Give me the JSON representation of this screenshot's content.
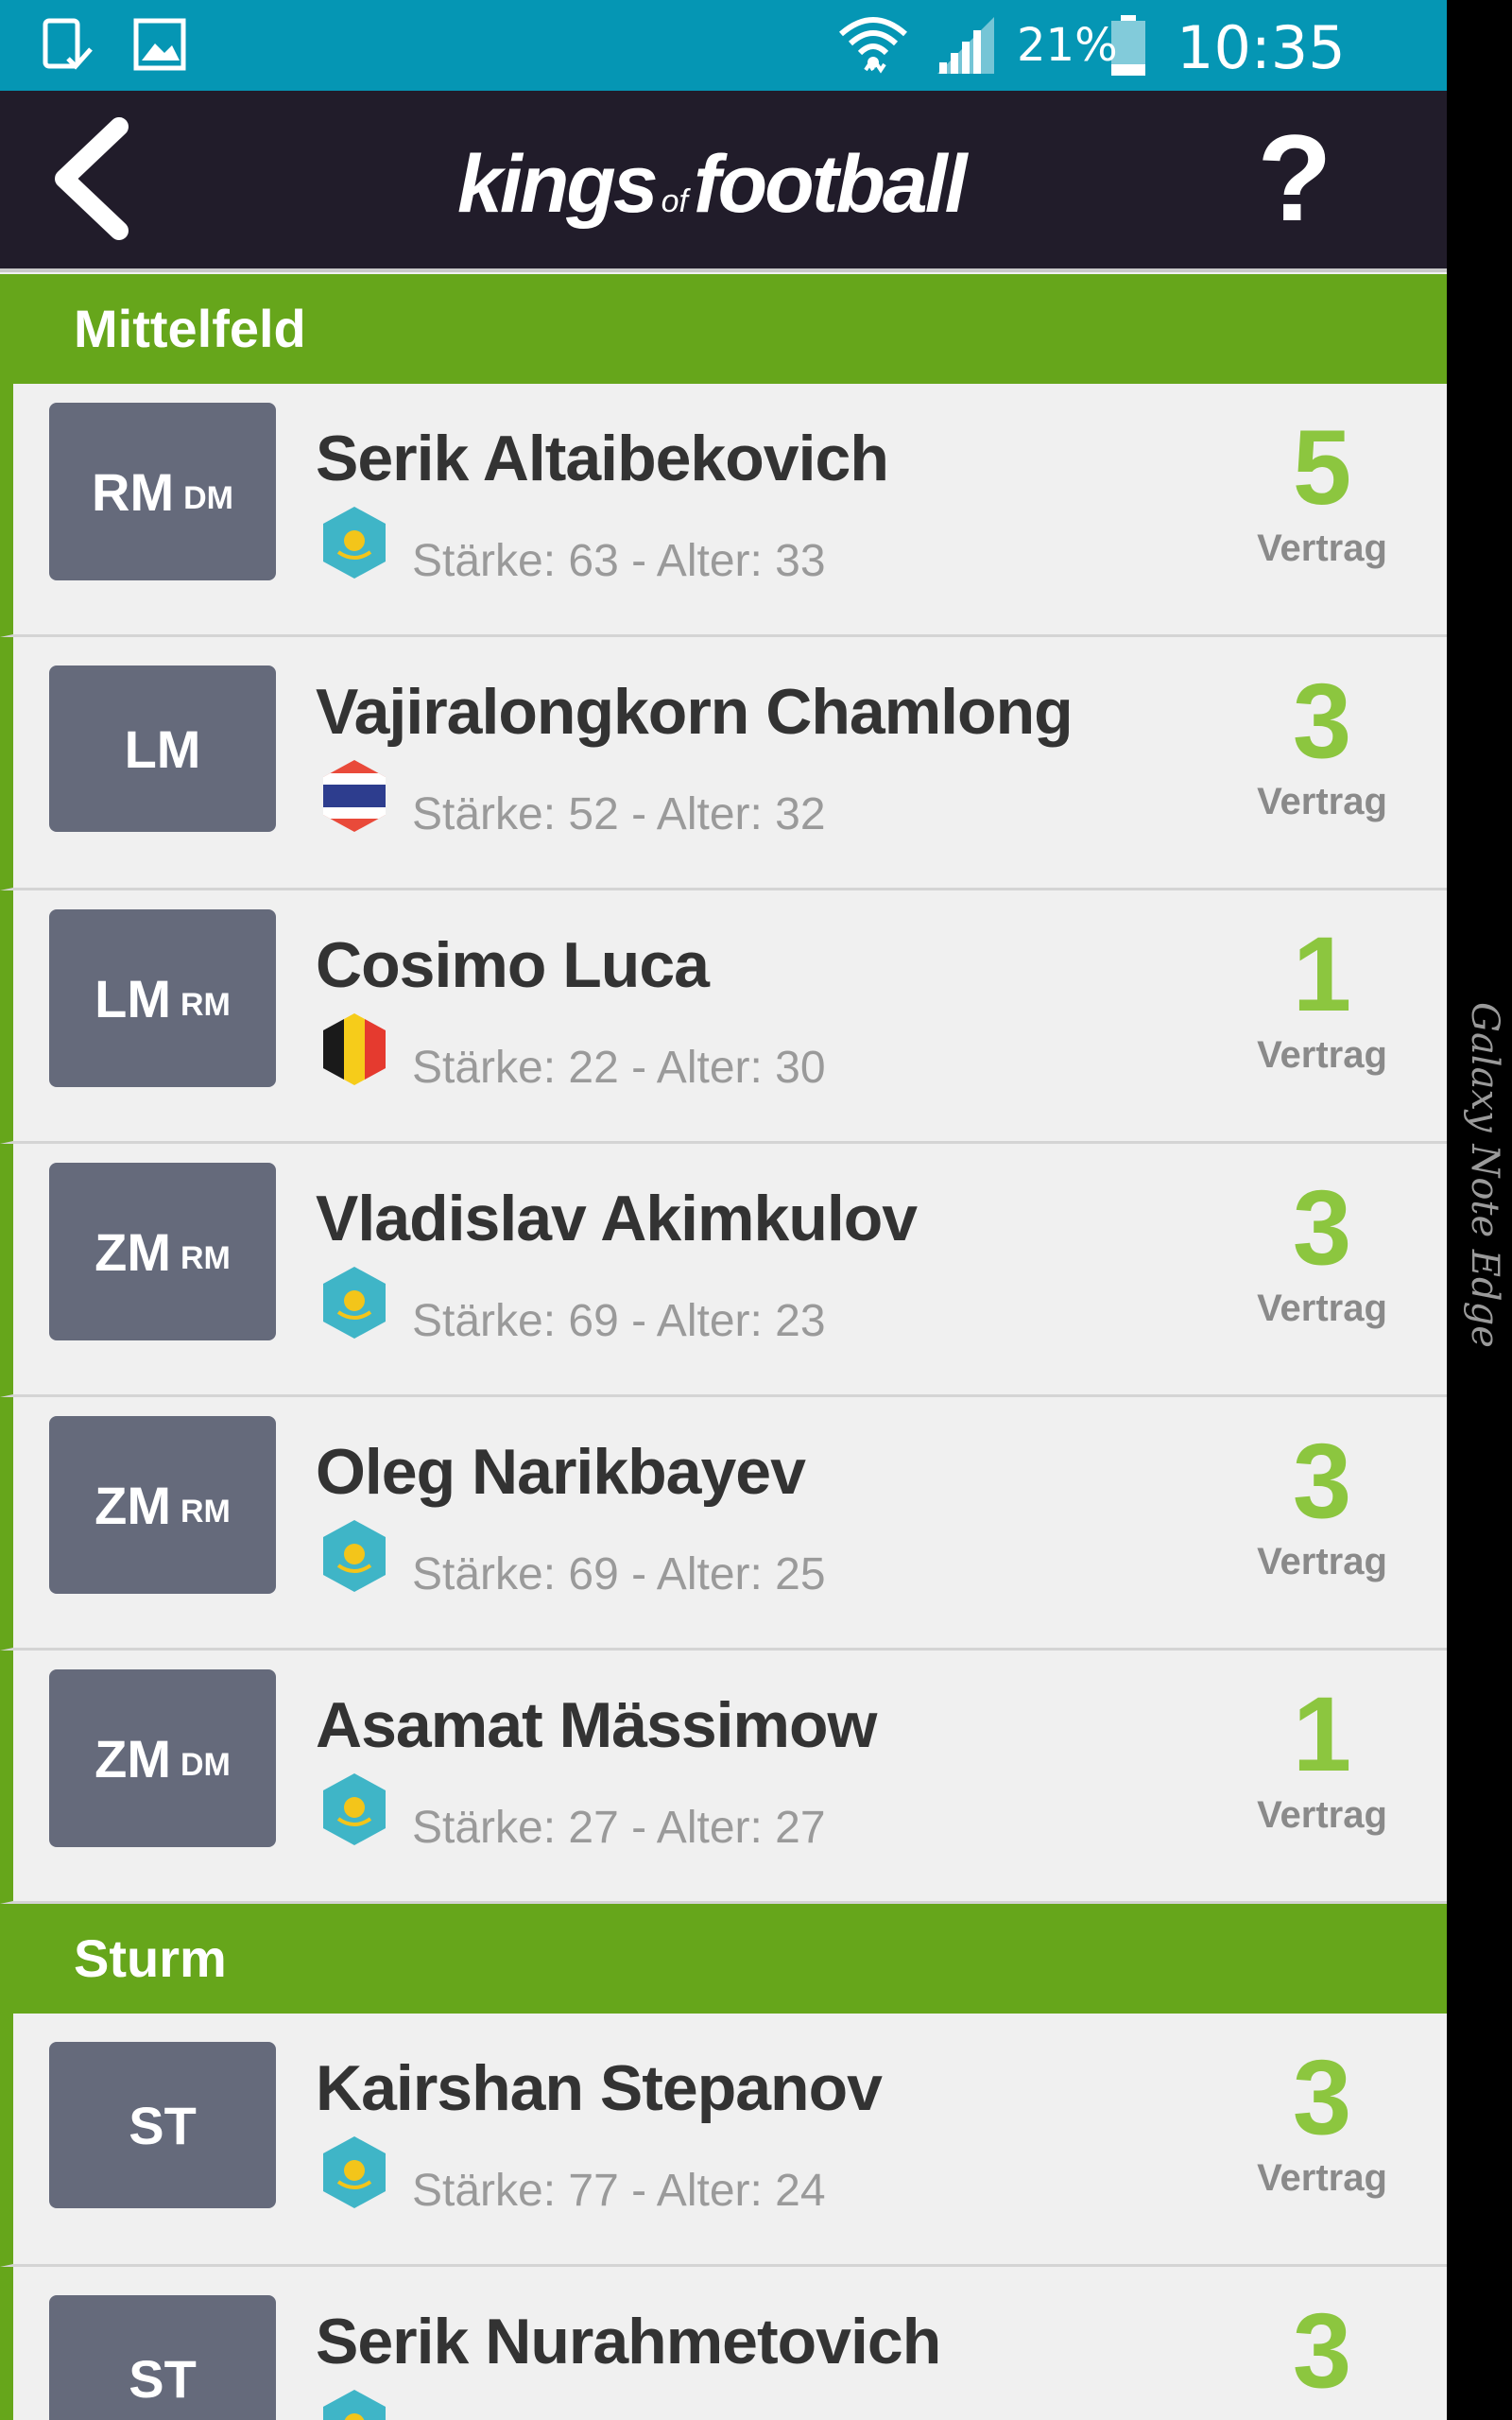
{
  "status_bar": {
    "battery_text": "21%",
    "time": "10:35"
  },
  "header": {
    "logo_part1": "kings",
    "logo_part2": "of",
    "logo_part3": "football",
    "help_label": "?"
  },
  "sections": [
    {
      "title": "Mittelfeld",
      "players": [
        {
          "pos_main": "RM",
          "pos_sec": "DM",
          "name": "Serik Altaibekovich",
          "flag": "kazakhstan-flag-icon",
          "stats": "Stärke: 63 - Alter: 33",
          "contract": "5",
          "contract_label": "Vertrag"
        },
        {
          "pos_main": "LM",
          "pos_sec": "",
          "name": "Vajiralongkorn Chamlong",
          "flag": "thailand-flag-icon",
          "stats": "Stärke: 52 - Alter: 32",
          "contract": "3",
          "contract_label": "Vertrag"
        },
        {
          "pos_main": "LM",
          "pos_sec": "RM",
          "name": "Cosimo Luca",
          "flag": "belgium-flag-icon",
          "stats": "Stärke: 22 - Alter: 30",
          "contract": "1",
          "contract_label": "Vertrag"
        },
        {
          "pos_main": "ZM",
          "pos_sec": "RM",
          "name": "Vladislav Akimkulov",
          "flag": "kazakhstan-flag-icon",
          "stats": "Stärke: 69 - Alter: 23",
          "contract": "3",
          "contract_label": "Vertrag"
        },
        {
          "pos_main": "ZM",
          "pos_sec": "RM",
          "name": "Oleg Narikbayev",
          "flag": "kazakhstan-flag-icon",
          "stats": "Stärke: 69 - Alter: 25",
          "contract": "3",
          "contract_label": "Vertrag"
        },
        {
          "pos_main": "ZM",
          "pos_sec": "DM",
          "name": "Asamat Mässimow",
          "flag": "kazakhstan-flag-icon",
          "stats": "Stärke: 27 - Alter: 27",
          "contract": "1",
          "contract_label": "Vertrag"
        }
      ]
    },
    {
      "title": "Sturm",
      "players": [
        {
          "pos_main": "ST",
          "pos_sec": "",
          "name": "Kairshan Stepanov",
          "flag": "kazakhstan-flag-icon",
          "stats": "Stärke: 77 - Alter: 24",
          "contract": "3",
          "contract_label": "Vertrag"
        },
        {
          "pos_main": "ST",
          "pos_sec": "",
          "name": "Serik Nurahmetovich",
          "flag": "kazakhstan-flag-icon",
          "stats": "",
          "contract": "3",
          "contract_label": ""
        }
      ]
    }
  ],
  "device_edge_label": "Galaxy Note Edge",
  "colors": {
    "status_bar": "#0596b4",
    "header": "#211c2a",
    "section_green": "#66a61b",
    "contract_green": "#8cc63f",
    "position_box": "#656a7b"
  }
}
